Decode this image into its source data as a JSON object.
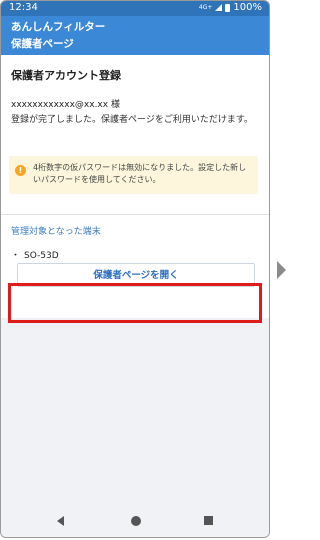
{
  "status_bar": {
    "time": "12:34",
    "network": "4G+",
    "battery": "100%"
  },
  "app_bar": {
    "app_name": "あんしんフィルター",
    "page_name": "保護者ページ"
  },
  "content": {
    "title": "保護者アカウント登録",
    "account": "xxxxxxxxxxxx@xx.xx 様",
    "message": "登録が完了しました。保護者ページをご利用いただけます。",
    "notice": "4桁数字の仮パスワードは無効になりました。設定した新しいパスワードを使用してください。"
  },
  "devices": {
    "title": "管理対象となった端末",
    "items": [
      "SO-53D"
    ]
  },
  "action": {
    "open_button": "保護者ページを開く"
  },
  "colors": {
    "header": "#3a88d6",
    "status_bar": "#2f73b8",
    "highlight": "#e01b1b",
    "link": "#2d6fc0"
  },
  "icons": {
    "warning": "warning-icon",
    "back": "back-triangle-icon",
    "home": "home-circle-icon",
    "recent": "recent-square-icon",
    "next": "next-arrow-icon"
  }
}
